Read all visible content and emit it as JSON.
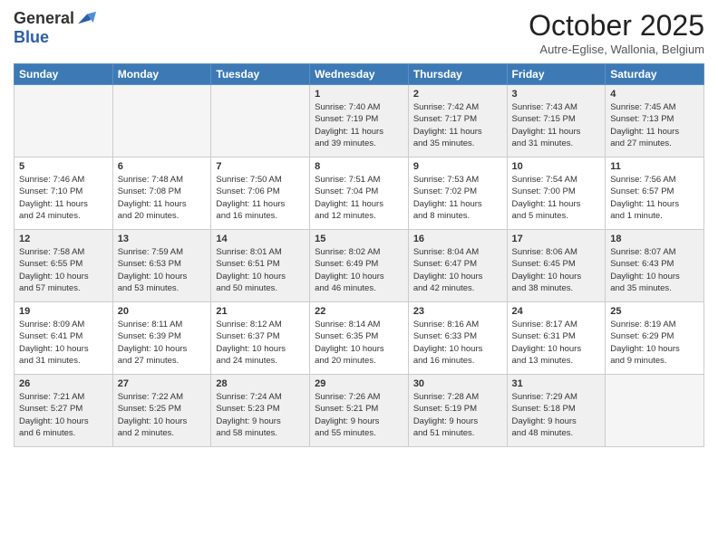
{
  "logo": {
    "general": "General",
    "blue": "Blue"
  },
  "header": {
    "month": "October 2025",
    "location": "Autre-Eglise, Wallonia, Belgium"
  },
  "weekdays": [
    "Sunday",
    "Monday",
    "Tuesday",
    "Wednesday",
    "Thursday",
    "Friday",
    "Saturday"
  ],
  "weeks": [
    [
      {
        "day": "",
        "info": ""
      },
      {
        "day": "",
        "info": ""
      },
      {
        "day": "",
        "info": ""
      },
      {
        "day": "1",
        "info": "Sunrise: 7:40 AM\nSunset: 7:19 PM\nDaylight: 11 hours\nand 39 minutes."
      },
      {
        "day": "2",
        "info": "Sunrise: 7:42 AM\nSunset: 7:17 PM\nDaylight: 11 hours\nand 35 minutes."
      },
      {
        "day": "3",
        "info": "Sunrise: 7:43 AM\nSunset: 7:15 PM\nDaylight: 11 hours\nand 31 minutes."
      },
      {
        "day": "4",
        "info": "Sunrise: 7:45 AM\nSunset: 7:13 PM\nDaylight: 11 hours\nand 27 minutes."
      }
    ],
    [
      {
        "day": "5",
        "info": "Sunrise: 7:46 AM\nSunset: 7:10 PM\nDaylight: 11 hours\nand 24 minutes."
      },
      {
        "day": "6",
        "info": "Sunrise: 7:48 AM\nSunset: 7:08 PM\nDaylight: 11 hours\nand 20 minutes."
      },
      {
        "day": "7",
        "info": "Sunrise: 7:50 AM\nSunset: 7:06 PM\nDaylight: 11 hours\nand 16 minutes."
      },
      {
        "day": "8",
        "info": "Sunrise: 7:51 AM\nSunset: 7:04 PM\nDaylight: 11 hours\nand 12 minutes."
      },
      {
        "day": "9",
        "info": "Sunrise: 7:53 AM\nSunset: 7:02 PM\nDaylight: 11 hours\nand 8 minutes."
      },
      {
        "day": "10",
        "info": "Sunrise: 7:54 AM\nSunset: 7:00 PM\nDaylight: 11 hours\nand 5 minutes."
      },
      {
        "day": "11",
        "info": "Sunrise: 7:56 AM\nSunset: 6:57 PM\nDaylight: 11 hours\nand 1 minute."
      }
    ],
    [
      {
        "day": "12",
        "info": "Sunrise: 7:58 AM\nSunset: 6:55 PM\nDaylight: 10 hours\nand 57 minutes."
      },
      {
        "day": "13",
        "info": "Sunrise: 7:59 AM\nSunset: 6:53 PM\nDaylight: 10 hours\nand 53 minutes."
      },
      {
        "day": "14",
        "info": "Sunrise: 8:01 AM\nSunset: 6:51 PM\nDaylight: 10 hours\nand 50 minutes."
      },
      {
        "day": "15",
        "info": "Sunrise: 8:02 AM\nSunset: 6:49 PM\nDaylight: 10 hours\nand 46 minutes."
      },
      {
        "day": "16",
        "info": "Sunrise: 8:04 AM\nSunset: 6:47 PM\nDaylight: 10 hours\nand 42 minutes."
      },
      {
        "day": "17",
        "info": "Sunrise: 8:06 AM\nSunset: 6:45 PM\nDaylight: 10 hours\nand 38 minutes."
      },
      {
        "day": "18",
        "info": "Sunrise: 8:07 AM\nSunset: 6:43 PM\nDaylight: 10 hours\nand 35 minutes."
      }
    ],
    [
      {
        "day": "19",
        "info": "Sunrise: 8:09 AM\nSunset: 6:41 PM\nDaylight: 10 hours\nand 31 minutes."
      },
      {
        "day": "20",
        "info": "Sunrise: 8:11 AM\nSunset: 6:39 PM\nDaylight: 10 hours\nand 27 minutes."
      },
      {
        "day": "21",
        "info": "Sunrise: 8:12 AM\nSunset: 6:37 PM\nDaylight: 10 hours\nand 24 minutes."
      },
      {
        "day": "22",
        "info": "Sunrise: 8:14 AM\nSunset: 6:35 PM\nDaylight: 10 hours\nand 20 minutes."
      },
      {
        "day": "23",
        "info": "Sunrise: 8:16 AM\nSunset: 6:33 PM\nDaylight: 10 hours\nand 16 minutes."
      },
      {
        "day": "24",
        "info": "Sunrise: 8:17 AM\nSunset: 6:31 PM\nDaylight: 10 hours\nand 13 minutes."
      },
      {
        "day": "25",
        "info": "Sunrise: 8:19 AM\nSunset: 6:29 PM\nDaylight: 10 hours\nand 9 minutes."
      }
    ],
    [
      {
        "day": "26",
        "info": "Sunrise: 7:21 AM\nSunset: 5:27 PM\nDaylight: 10 hours\nand 6 minutes."
      },
      {
        "day": "27",
        "info": "Sunrise: 7:22 AM\nSunset: 5:25 PM\nDaylight: 10 hours\nand 2 minutes."
      },
      {
        "day": "28",
        "info": "Sunrise: 7:24 AM\nSunset: 5:23 PM\nDaylight: 9 hours\nand 58 minutes."
      },
      {
        "day": "29",
        "info": "Sunrise: 7:26 AM\nSunset: 5:21 PM\nDaylight: 9 hours\nand 55 minutes."
      },
      {
        "day": "30",
        "info": "Sunrise: 7:28 AM\nSunset: 5:19 PM\nDaylight: 9 hours\nand 51 minutes."
      },
      {
        "day": "31",
        "info": "Sunrise: 7:29 AM\nSunset: 5:18 PM\nDaylight: 9 hours\nand 48 minutes."
      },
      {
        "day": "",
        "info": ""
      }
    ]
  ]
}
